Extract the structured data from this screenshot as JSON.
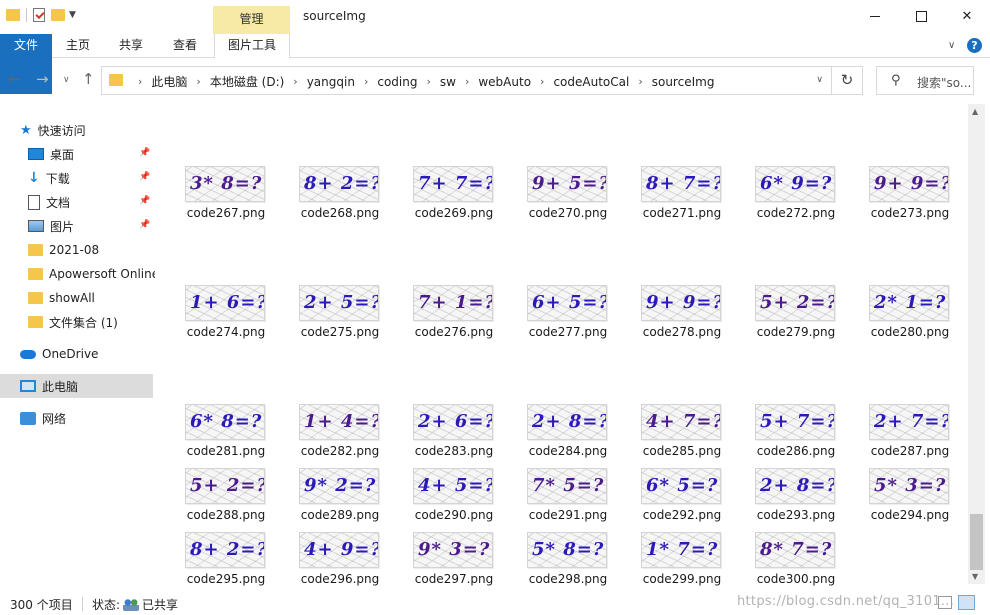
{
  "window": {
    "title": "sourceImg",
    "context_tab_group": "管理"
  },
  "ribbon": {
    "tabs": [
      "文件",
      "主页",
      "共享",
      "查看",
      "图片工具"
    ]
  },
  "address": {
    "crumbs": [
      "此电脑",
      "本地磁盘 (D:)",
      "yangqin",
      "coding",
      "sw",
      "webAuto",
      "codeAutoCal",
      "sourceImg"
    ]
  },
  "search": {
    "placeholder": "搜索\"so..."
  },
  "nav": {
    "quick_access": "快速访问",
    "items": [
      {
        "label": "桌面",
        "icon": "desktop-icon",
        "pinned": true
      },
      {
        "label": "下载",
        "icon": "download-icon",
        "pinned": true
      },
      {
        "label": "文档",
        "icon": "document-icon",
        "pinned": true
      },
      {
        "label": "图片",
        "icon": "pictures-icon",
        "pinned": true
      },
      {
        "label": "2021-08",
        "icon": "folder-icon",
        "pinned": false
      },
      {
        "label": "Apowersoft Online",
        "icon": "folder-icon",
        "pinned": false
      },
      {
        "label": "showAll",
        "icon": "folder-icon",
        "pinned": false
      },
      {
        "label": "文件集合 (1)",
        "icon": "folder-icon",
        "pinned": false
      }
    ],
    "onedrive": "OneDrive",
    "this_pc": "此电脑",
    "network": "网络"
  },
  "files": [
    {
      "name": "code267.png",
      "captcha": "3* 8=?"
    },
    {
      "name": "code268.png",
      "captcha": "8+ 2=?"
    },
    {
      "name": "code269.png",
      "captcha": "7+ 7=?"
    },
    {
      "name": "code270.png",
      "captcha": "9+ 5=?"
    },
    {
      "name": "code271.png",
      "captcha": "8+ 7=?"
    },
    {
      "name": "code272.png",
      "captcha": "6* 9=?"
    },
    {
      "name": "code273.png",
      "captcha": "9+ 9=?"
    },
    {
      "name": "code274.png",
      "captcha": "1+ 6=?"
    },
    {
      "name": "code275.png",
      "captcha": "2+ 5=?"
    },
    {
      "name": "code276.png",
      "captcha": "7+ 1=?"
    },
    {
      "name": "code277.png",
      "captcha": "6+ 5=?"
    },
    {
      "name": "code278.png",
      "captcha": "9+ 9=?"
    },
    {
      "name": "code279.png",
      "captcha": "5+ 2=?"
    },
    {
      "name": "code280.png",
      "captcha": "2* 1=?"
    },
    {
      "name": "code281.png",
      "captcha": "6* 8=?"
    },
    {
      "name": "code282.png",
      "captcha": "1+ 4=?"
    },
    {
      "name": "code283.png",
      "captcha": "2+ 6=?"
    },
    {
      "name": "code284.png",
      "captcha": "2+ 8=?"
    },
    {
      "name": "code285.png",
      "captcha": "4+ 7=?"
    },
    {
      "name": "code286.png",
      "captcha": "5+ 7=?"
    },
    {
      "name": "code287.png",
      "captcha": "2+ 7=?"
    },
    {
      "name": "code288.png",
      "captcha": "5+ 2=?"
    },
    {
      "name": "code289.png",
      "captcha": "9* 2=?"
    },
    {
      "name": "code290.png",
      "captcha": "4+ 5=?"
    },
    {
      "name": "code291.png",
      "captcha": "7* 5=?"
    },
    {
      "name": "code292.png",
      "captcha": "6* 5=?"
    },
    {
      "name": "code293.png",
      "captcha": "2+ 8=?"
    },
    {
      "name": "code294.png",
      "captcha": "5* 3=?"
    },
    {
      "name": "code295.png",
      "captcha": "8+ 2=?"
    },
    {
      "name": "code296.png",
      "captcha": "4+ 9=?"
    },
    {
      "name": "code297.png",
      "captcha": "9* 3=?"
    },
    {
      "name": "code298.png",
      "captcha": "5* 8=?"
    },
    {
      "name": "code299.png",
      "captcha": "1* 7=?"
    },
    {
      "name": "code300.png",
      "captcha": "8* 7=?"
    }
  ],
  "status": {
    "count": "300 个项目",
    "state": "状态: ",
    "shared": "已共享"
  },
  "watermark": "https://blog.csdn.net/qq_3101..."
}
